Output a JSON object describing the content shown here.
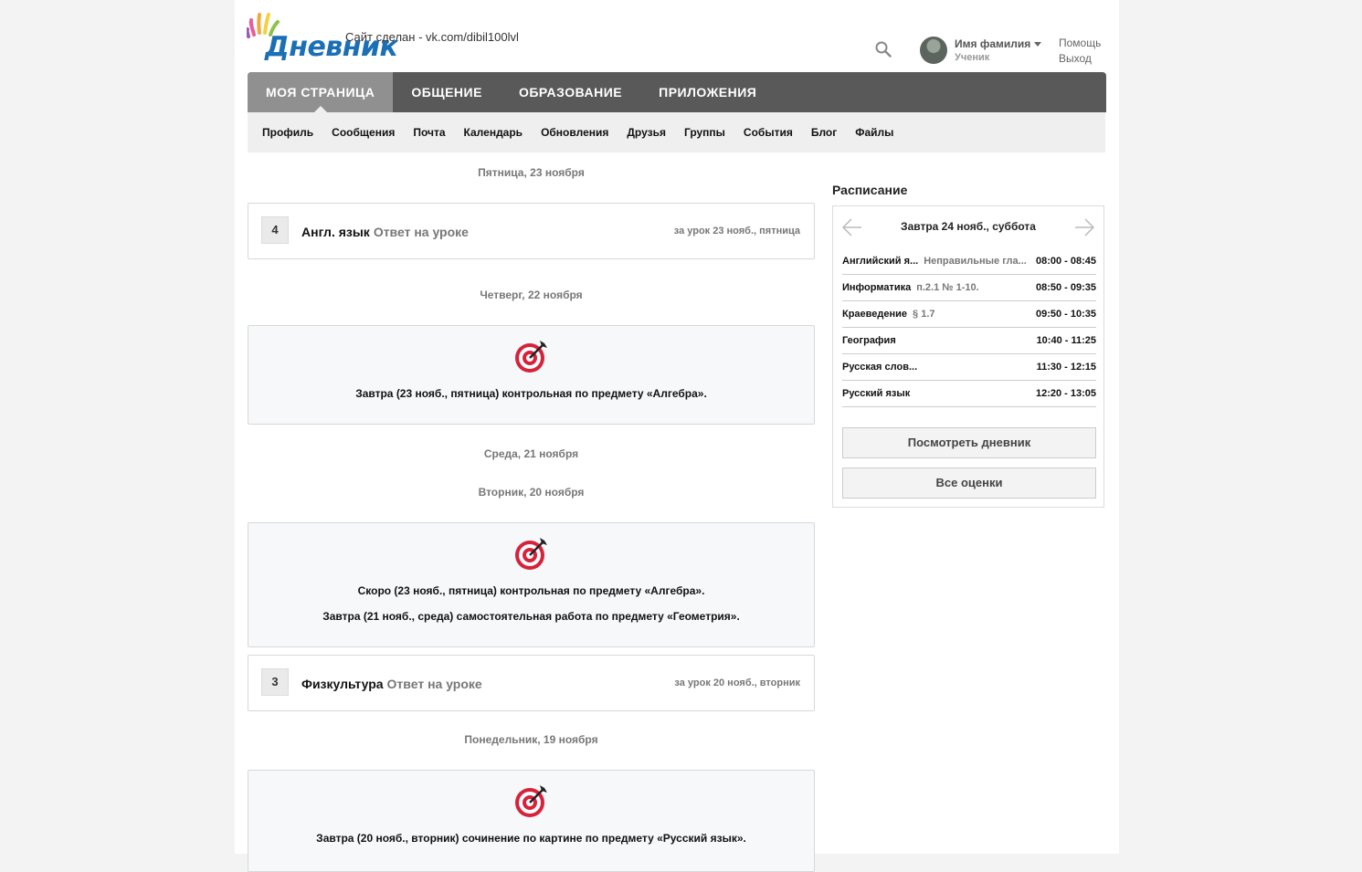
{
  "header": {
    "logo_text": "Дневник",
    "credit": "Сайт сделан - vk.com/dibil100lvl",
    "user_name": "Имя фамилия",
    "user_role": "Ученик",
    "help": "Помощь",
    "exit": "Выход"
  },
  "mainnav": [
    "МОЯ СТРАНИЦА",
    "ОБЩЕНИЕ",
    "ОБРАЗОВАНИЕ",
    "ПРИЛОЖЕНИЯ"
  ],
  "subnav": [
    "Профиль",
    "Сообщения",
    "Почта",
    "Календарь",
    "Обновления",
    "Друзья",
    "Группы",
    "События",
    "Блог",
    "Файлы"
  ],
  "feed": {
    "d1": "Пятница, 23 ноября",
    "m1": {
      "mark": "4",
      "subject": "Англ. язык",
      "type": "Ответ на уроке",
      "when": "за урок 23 нояб., пятница"
    },
    "d2": "Четверг, 22 ноября",
    "e1": [
      "Завтра (23 нояб., пятница) контрольная по предмету «Алгебра»."
    ],
    "d3": "Среда, 21 ноября",
    "d4": "Вторник, 20 ноября",
    "e2": [
      "Скоро (23 нояб., пятница) контрольная по предмету «Алгебра».",
      "Завтра (21 нояб., среда) самостоятельная работа по предмету «Геометрия»."
    ],
    "m2": {
      "mark": "3",
      "subject": "Физкультура",
      "type": "Ответ на уроке",
      "when": "за урок 20 нояб., вторник"
    },
    "d5": "Понедельник, 19 ноября",
    "e3": [
      "Завтра (20 нояб., вторник) сочинение по картине по предмету «Русский язык»."
    ]
  },
  "schedule": {
    "title": "Расписание",
    "day": "Завтра 24 нояб., суббота",
    "rows": [
      {
        "subject": "Английский я...",
        "hw": "Неправильные гла...",
        "time": "08:00 - 08:45"
      },
      {
        "subject": "Информатика",
        "hw": "п.2.1 № 1-10.",
        "time": "08:50 - 09:35"
      },
      {
        "subject": "Краеведение",
        "hw": "§ 1.7",
        "time": "09:50 - 10:35"
      },
      {
        "subject": "География",
        "hw": "",
        "time": "10:40 - 11:25"
      },
      {
        "subject": "Русская слов...",
        "hw": "",
        "time": "11:30 - 12:15"
      },
      {
        "subject": "Русский язык",
        "hw": "",
        "time": "12:20 - 13:05"
      }
    ],
    "btn_diary": "Посмотреть дневник",
    "btn_marks": "Все оценки"
  },
  "colors": {
    "nav_bg": "#595959",
    "nav_active": "#909090",
    "logo_blue": "#1b6fb5",
    "target_red": "#d6223a"
  },
  "icons": [
    "search-icon",
    "target-icon",
    "arrow-left-icon",
    "arrow-right-icon"
  ]
}
